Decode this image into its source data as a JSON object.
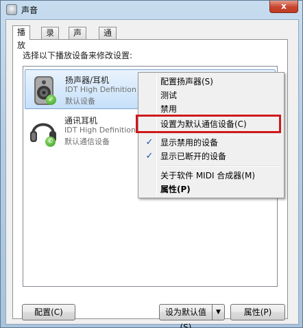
{
  "window": {
    "title": "声音",
    "close_label": "x"
  },
  "tabs": [
    {
      "label": "播放",
      "active": true
    },
    {
      "label": "录制",
      "active": false
    },
    {
      "label": "声音",
      "active": false
    },
    {
      "label": "通信",
      "active": false
    }
  ],
  "instruction": "选择以下播放设备来修改设置:",
  "devices": [
    {
      "name": "扬声器/耳机",
      "description": "IDT High Definition A",
      "status": "默认设备",
      "icon": "speaker-icon",
      "badge": "default-check-badge",
      "selected": true
    },
    {
      "name": "通讯耳机",
      "description": "IDT High Definition A",
      "status": "默认通信设备",
      "icon": "headphones-icon",
      "badge": "phone-badge",
      "selected": false
    }
  ],
  "context_menu": {
    "items": [
      {
        "label": "配置扬声器(S)"
      },
      {
        "label": "测试"
      },
      {
        "label": "禁用"
      },
      {
        "label": "设置为默认通信设备(C)"
      },
      {
        "label": "显示禁用的设备",
        "checked": true
      },
      {
        "label": "显示已断开的设备",
        "checked": true
      },
      {
        "label": "关于软件 MIDI 合成器(M)"
      },
      {
        "label": "属性(P)",
        "bold": true
      }
    ],
    "highlight_color": "#d0171a"
  },
  "buttons": {
    "configure": "配置(C)",
    "set_default": "设为默认值(S)",
    "set_default_arrow": "▼",
    "properties": "属性(P)"
  },
  "colors": {
    "selection": "#c6e0fa",
    "check": "#1b4fb0",
    "badge_green": "#2e9a19"
  }
}
